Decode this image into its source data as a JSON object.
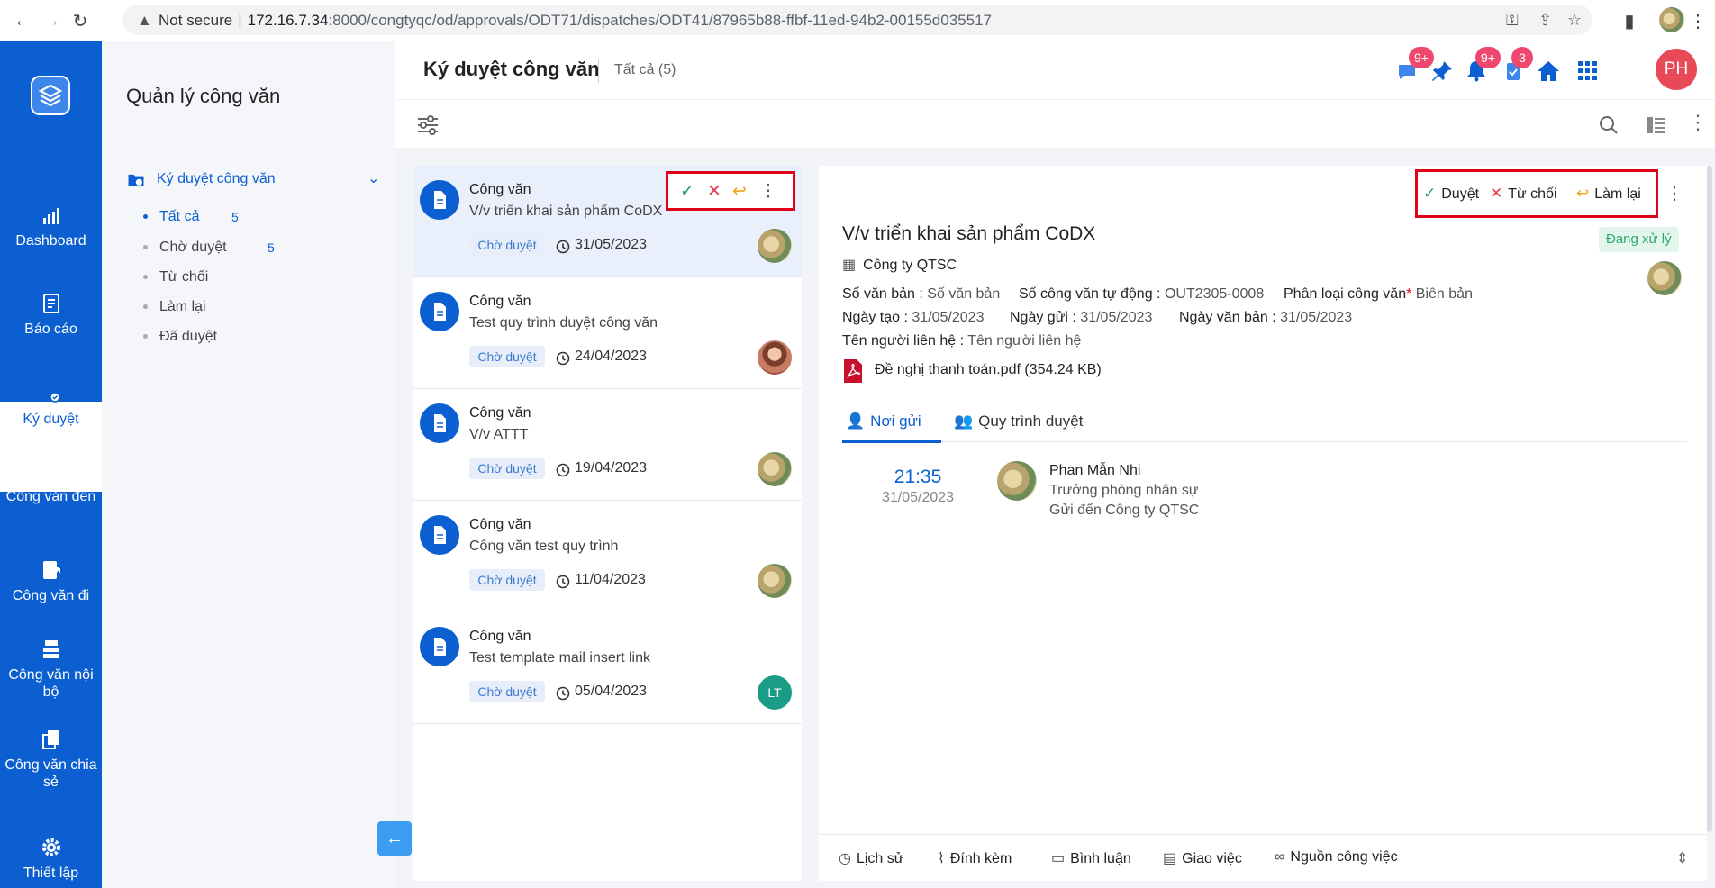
{
  "browser": {
    "security": "Not secure",
    "host": "172.16.7.34",
    "path": ":8000/congtyqc/od/approvals/ODT71/dispatches/ODT41/87965b88-ffbf-11ed-94b2-00155d035517"
  },
  "nav": {
    "items": [
      {
        "label": "Dashboard"
      },
      {
        "label": "Báo cáo"
      },
      {
        "label": "Ký duyệt"
      },
      {
        "label": "Công văn đến"
      },
      {
        "label": "Công văn đi"
      },
      {
        "label": "Công văn nội bộ"
      },
      {
        "label": "Công văn chia sẻ"
      },
      {
        "label": "Thiết lập"
      }
    ]
  },
  "module": {
    "title": "Quản lý công văn",
    "group": "Ký duyệt công văn",
    "subs": [
      {
        "label": "Tất cả",
        "count": "5"
      },
      {
        "label": "Chờ duyệt",
        "count": "5"
      },
      {
        "label": "Từ chối",
        "count": ""
      },
      {
        "label": "Làm lại",
        "count": ""
      },
      {
        "label": "Đã duyệt",
        "count": ""
      }
    ]
  },
  "header": {
    "title": "Ký duyệt công văn",
    "count_label": "Tất cả (5)",
    "badge_messages": "9+",
    "badge_notifications": "9+",
    "badge_tasks": "3",
    "avatar_initials": "PH"
  },
  "list": [
    {
      "type": "Công văn",
      "subject": "V/v triển khai sản phẩm CoDX",
      "status": "Chờ duyệt",
      "date": "31/05/2023",
      "avatar": "photo"
    },
    {
      "type": "Công văn",
      "subject": "Test quy trình duyệt công văn",
      "status": "Chờ duyệt",
      "date": "24/04/2023",
      "avatar": "photo2"
    },
    {
      "type": "Công văn",
      "subject": "V/v ATTT",
      "status": "Chờ duyệt",
      "date": "19/04/2023",
      "avatar": "photo"
    },
    {
      "type": "Công văn",
      "subject": "Công văn test quy trình",
      "status": "Chờ duyệt",
      "date": "11/04/2023",
      "avatar": "photo"
    },
    {
      "type": "Công văn",
      "subject": "Test template mail insert link",
      "status": "Chờ duyệt",
      "date": "05/04/2023",
      "avatar": "LT"
    }
  ],
  "detail": {
    "actions": {
      "approve": "Duyệt",
      "reject": "Từ chối",
      "redo": "Làm lại"
    },
    "title": "V/v triển khai sản phẩm CoDX",
    "status": "Đang xử lý",
    "org": "Công ty QTSC",
    "meta": {
      "so_van_ban_label": "Số văn bản :",
      "so_van_ban": "Số văn bản",
      "so_cv_tu_dong_label": "Số công văn tự động :",
      "so_cv_tu_dong": "OUT2305-0008",
      "phan_loai_label": "Phân loại công văn",
      "phan_loai_req": "*",
      "phan_loai": "Biên bản",
      "ngay_tao_label": "Ngày tạo :",
      "ngay_tao": "31/05/2023",
      "ngay_gui_label": "Ngày gửi :",
      "ngay_gui": "31/05/2023",
      "ngay_van_ban_label": "Ngày văn bản :",
      "ngay_van_ban": "31/05/2023",
      "ten_nguoi_lien_he_label": "Tên người liên hệ :",
      "ten_nguoi_lien_he": "Tên người liên hệ"
    },
    "attachment": "Đề nghị thanh toán.pdf (354.24 KB)",
    "tabs": {
      "sender": "Nơi gửi",
      "workflow": "Quy trình duyệt"
    },
    "sender": {
      "time": "21:35",
      "date": "31/05/2023",
      "name": "Phan Mẫn Nhi",
      "position": "Trưởng phòng nhân sự",
      "sent_to": "Gửi đến Công ty QTSC"
    },
    "footer": {
      "history": "Lịch sử",
      "attach": "Đính kèm",
      "comment": "Bình luận",
      "assign": "Giao việc",
      "source": "Nguồn công việc"
    }
  },
  "colors": {
    "primary": "#0b5fd0",
    "highlight": "#e0001a",
    "badge": "#f0476e"
  }
}
